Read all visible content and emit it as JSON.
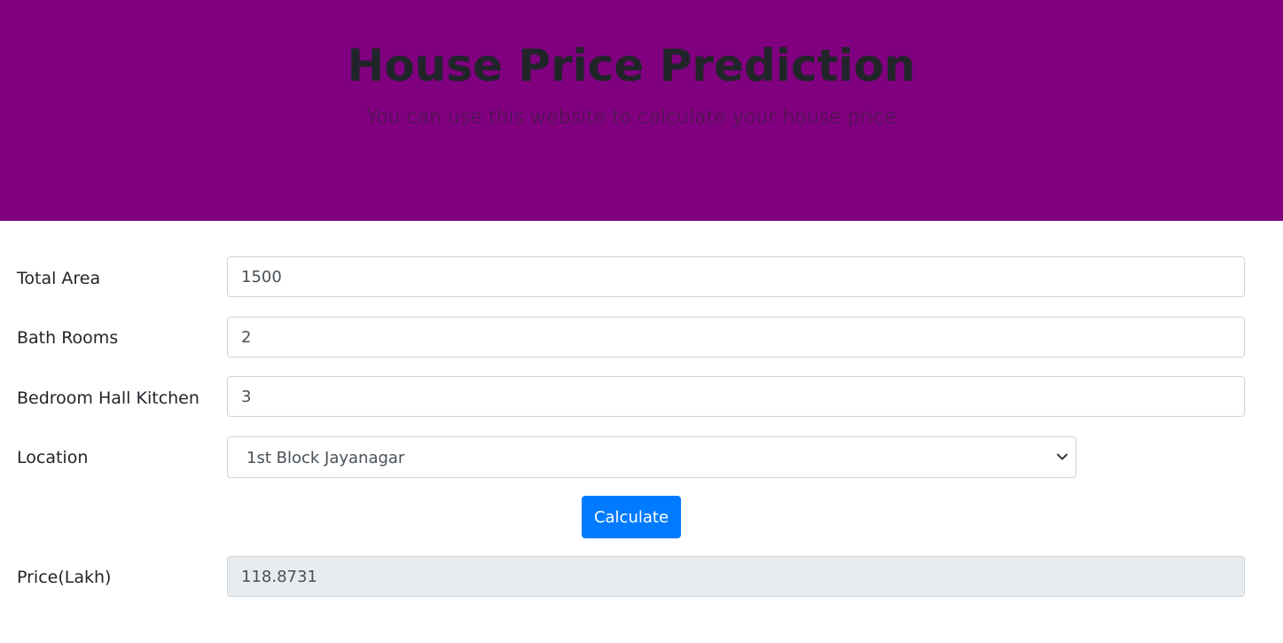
{
  "header": {
    "title": "House Price Prediction",
    "subtitle": "You can use this website to calculate your house price"
  },
  "form": {
    "total_area": {
      "label": "Total Area",
      "value": "1500"
    },
    "bath_rooms": {
      "label": "Bath Rooms",
      "value": "2"
    },
    "bhk": {
      "label": "Bedroom Hall Kitchen",
      "value": "3"
    },
    "location": {
      "label": "Location",
      "selected": "1st Block Jayanagar"
    },
    "calculate_label": "Calculate",
    "price": {
      "label": "Price(Lakh)",
      "value": "118.8731"
    }
  },
  "colors": {
    "header_bg": "#800080",
    "button_bg": "#007bff",
    "readonly_bg": "#e9ecef"
  },
  "icons": {
    "select_arrow": "chevron-down-icon"
  }
}
